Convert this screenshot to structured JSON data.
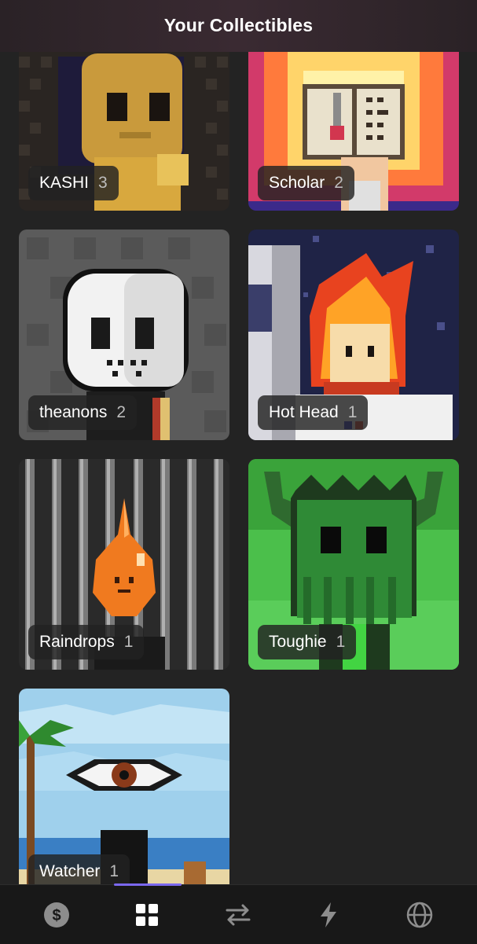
{
  "header": {
    "title": "Your Collectibles"
  },
  "collectibles": [
    {
      "name": "KASHI",
      "count": "3"
    },
    {
      "name": "Scholar",
      "count": "2"
    },
    {
      "name": "theanons",
      "count": "2"
    },
    {
      "name": "Hot Head",
      "count": "1"
    },
    {
      "name": "Raindrops",
      "count": "1"
    },
    {
      "name": "Toughie",
      "count": "1"
    },
    {
      "name": "Watcher",
      "count": "1"
    }
  ],
  "tabbar": {
    "tabs": [
      {
        "icon": "dollar-icon"
      },
      {
        "icon": "grid-icon",
        "selected": true
      },
      {
        "icon": "swap-arrows-icon"
      },
      {
        "icon": "lightning-icon"
      },
      {
        "icon": "globe-icon"
      }
    ],
    "accent": "#7b68ee"
  }
}
